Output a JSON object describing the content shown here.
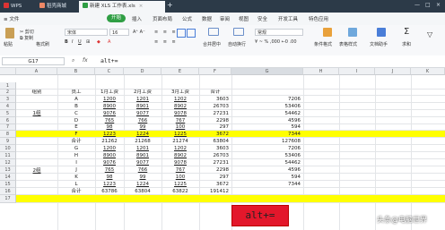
{
  "tabs": [
    {
      "label": "WPS"
    },
    {
      "label": "稻壳商城"
    },
    {
      "label": "新建 XLS 工作表.xls"
    }
  ],
  "menus": [
    "文件",
    "开始",
    "插入",
    "页面布局",
    "公式",
    "数据",
    "审阅",
    "视图",
    "安全",
    "开发工具",
    "特色应用"
  ],
  "active_menu_index": 1,
  "ribbon": {
    "paste": "粘贴",
    "cut": "剪切",
    "copy": "复制",
    "format_painter": "格式刷",
    "font": "宋体",
    "font_size": "16",
    "merge": "合并居中",
    "wrap": "自动换行",
    "number_format": "常规",
    "conditional": "条件格式",
    "table_style": "表格样式",
    "doc_helper": "文档助手",
    "sum": "求和"
  },
  "formula_bar": {
    "name_box": "G17",
    "fx": "fx",
    "formula": "alt+="
  },
  "columns": [
    "A",
    "B",
    "C",
    "D",
    "E",
    "F",
    "G",
    "H",
    "I",
    "J",
    "K"
  ],
  "rows": [
    "1",
    "2",
    "3",
    "4",
    "5",
    "6",
    "7",
    "8",
    "9",
    "10",
    "11",
    "12",
    "13",
    "14",
    "15",
    "16",
    "17"
  ],
  "sheet": {
    "header": [
      "组别",
      "员工",
      "1月工资",
      "2月工资",
      "3月工资",
      "合计"
    ],
    "g1_label": "1组",
    "g2_label": "2组",
    "g1_rows": [
      [
        "A",
        "1200",
        "1201",
        "1202",
        "3603",
        "7206"
      ],
      [
        "B",
        "8900",
        "8901",
        "8902",
        "26703",
        "53406"
      ],
      [
        "C",
        "9076",
        "9077",
        "9078",
        "27231",
        "54462"
      ],
      [
        "D",
        "765",
        "766",
        "767",
        "2298",
        "4596"
      ],
      [
        "E",
        "98",
        "99",
        "100",
        "297",
        "594"
      ],
      [
        "F",
        "1223",
        "1224",
        "1225",
        "3672",
        "7344"
      ]
    ],
    "g1_total": [
      "合计",
      "21262",
      "21268",
      "21274",
      "63804",
      "127608"
    ],
    "g2_rows": [
      [
        "G",
        "1200",
        "1201",
        "1202",
        "3603",
        "7206"
      ],
      [
        "H",
        "8900",
        "8901",
        "8902",
        "26703",
        "53406"
      ],
      [
        "I",
        "9076",
        "9077",
        "9078",
        "27231",
        "54462"
      ],
      [
        "J",
        "765",
        "766",
        "767",
        "2298",
        "4596"
      ],
      [
        "K",
        "98",
        "99",
        "100",
        "297",
        "594"
      ],
      [
        "L",
        "1223",
        "1224",
        "1225",
        "3672",
        "7344"
      ]
    ],
    "g2_total": [
      "合计",
      "63786",
      "63804",
      "63822",
      "191412",
      ""
    ]
  },
  "overlay_text": "alt+=",
  "watermark": "头条@电脑世界",
  "colors": {
    "accent": "#2f9e44",
    "highlight": "#ffff00",
    "overlay": "#e3172b",
    "titlebar": "#2c3a48"
  }
}
